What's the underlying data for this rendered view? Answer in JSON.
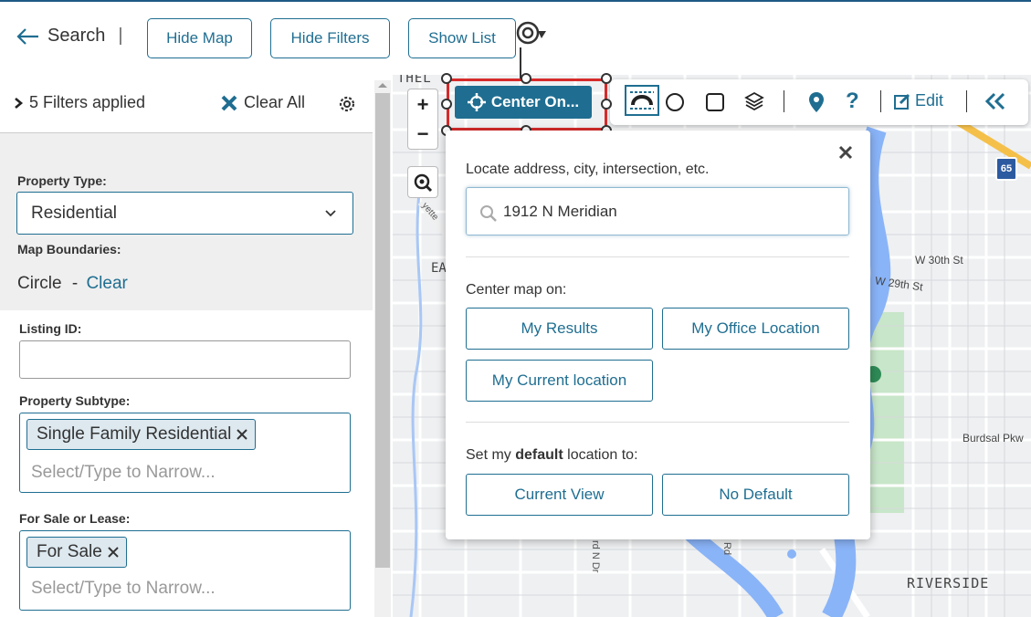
{
  "topbar": {
    "back_label": "Search",
    "separator": "|",
    "hide_map": "Hide Map",
    "hide_filters": "Hide Filters",
    "show_list": "Show List"
  },
  "filters": {
    "applied": "5 Filters applied",
    "clear_all": "Clear All"
  },
  "form": {
    "property_type_label": "Property Type:",
    "property_type_value": "Residential",
    "map_boundaries_label": "Map Boundaries:",
    "map_boundaries_value": "Circle",
    "map_boundaries_dash": "-",
    "map_boundaries_clear": "Clear",
    "listing_id_label": "Listing ID:",
    "listing_id_value": "",
    "property_subtype_label": "Property Subtype:",
    "property_subtype_tag": "Single Family Residential",
    "property_subtype_placeholder": "Select/Type to Narrow...",
    "for_sale_label": "For Sale or Lease:",
    "for_sale_tag": "For Sale",
    "for_sale_placeholder": "Select/Type to Narrow..."
  },
  "map": {
    "zoom_in": "+",
    "zoom_out": "−",
    "center_on": "Center On...",
    "edit": "Edit",
    "labels": {
      "w30": "W 30th St",
      "w29_prefix": "W",
      "w29_number": "29",
      "w29_suffix": "th St",
      "burdsal": "Burdsal Pkw",
      "riverside": "RIVERSIDE",
      "hwy": "65",
      "top_cut": "THEL",
      "left_cut": "EA",
      "vertical_1": "rd N Dr",
      "vertical_2": "Rd",
      "vertical_3": "yette"
    }
  },
  "popup": {
    "locate_label": "Locate address, city, intersection, etc.",
    "search_value": "1912 N Meridian",
    "center_map_label": "Center map on:",
    "my_results": "My Results",
    "my_office": "My Office Location",
    "my_current": "My Current location",
    "default_prefix": "Set my ",
    "default_bold": "default",
    "default_suffix": " location to:",
    "current_view": "Current View",
    "no_default": "No Default"
  },
  "colors": {
    "accent": "#1f6e91",
    "selection": "#d62b2b",
    "river": "#8ab4f8",
    "park": "#c8e6c9"
  }
}
